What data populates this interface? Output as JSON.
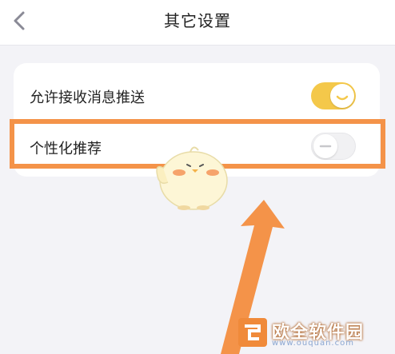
{
  "header": {
    "back_icon": "chevron-left-icon",
    "title": "其它设置"
  },
  "settings": {
    "items": [
      {
        "label": "允许接收消息推送",
        "enabled": true
      },
      {
        "label": "个性化推荐",
        "enabled": false
      }
    ]
  },
  "overlay": {
    "highlight_color": "#f49349",
    "arrow_color": "#f49349",
    "toggle_on_color": "#f4c84a"
  },
  "watermark": {
    "text": "欧全软件园",
    "url": "www.ouquan.com"
  }
}
